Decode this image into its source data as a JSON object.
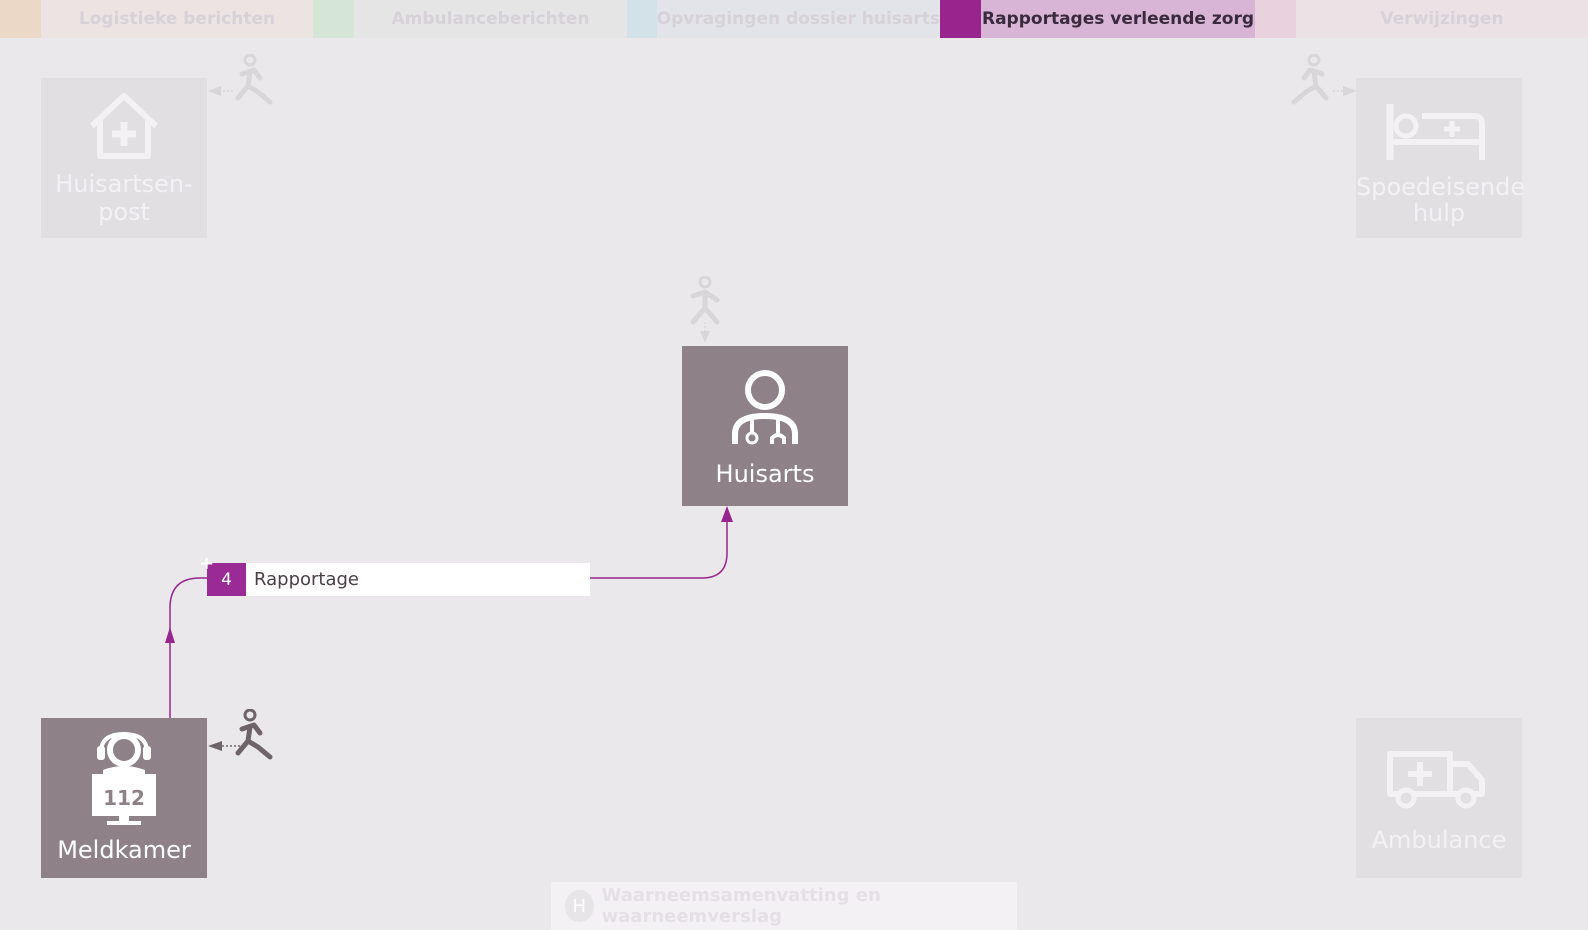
{
  "tabs": [
    {
      "label": "Logistieke berichten",
      "color": "#ecd8c7",
      "bg": "#ece3e3",
      "active": false
    },
    {
      "label": "Ambulanceberichten",
      "color": "#d5e5d6",
      "bg": "#e5e5e6",
      "active": false
    },
    {
      "label": "Opvragingen dossier huisarts",
      "color": "#d3e1e9",
      "bg": "#e3e4ea",
      "active": false
    },
    {
      "label": "Rapportages verleende zorg",
      "color": "#98258e",
      "bg": "#d8b5d6",
      "active": true
    },
    {
      "label": "Verwijzingen",
      "color": "#e9d2dd",
      "bg": "#ebe2e6",
      "active": false
    }
  ],
  "nodes": {
    "huisartsenpost": {
      "label": "Huisartsen-\npost",
      "icon": "house-plus-icon"
    },
    "spoedeisende_hulp": {
      "label": "Spoedeisende\nhulp",
      "icon": "hospital-bed-icon"
    },
    "huisarts": {
      "label": "Huisarts",
      "icon": "doctor-stethoscope-icon"
    },
    "meldkamer": {
      "label": "Meldkamer",
      "icon": "dispatcher-headset-icon",
      "screen_text": "112"
    },
    "ambulance": {
      "label": "Ambulance",
      "icon": "ambulance-icon"
    }
  },
  "message": {
    "number": "4",
    "label": "Rapportage"
  },
  "footer": {
    "badge": "H",
    "label": "Waarneemsamenvatting en waarneemverslag"
  },
  "colors": {
    "accent": "#98258e",
    "node_active": "#8e8288",
    "node_dim": "#e1dfe2",
    "background": "#eae8eb"
  }
}
